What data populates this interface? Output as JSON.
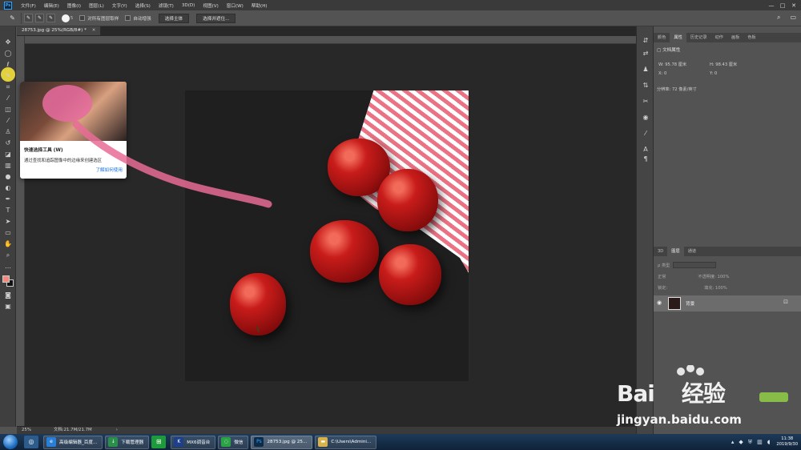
{
  "menu": {
    "items": [
      "文件(F)",
      "编辑(E)",
      "图像(I)",
      "图层(L)",
      "文字(Y)",
      "选择(S)",
      "滤镜(T)",
      "3D(D)",
      "视图(V)",
      "窗口(W)",
      "帮助(H)"
    ],
    "ps_logo": "Ps",
    "minimize": "—",
    "maximize": "□",
    "close": "✕"
  },
  "options": {
    "brush_size": "5",
    "sample_all_label": "对所有图层取样",
    "auto_enhance_label": "自动增强",
    "select_subject": "选择主体",
    "select_mask": "选择并遮住..."
  },
  "document": {
    "tab_title": "28753.jpg @ 25%(RGB/8#) *",
    "tab_close": "✕"
  },
  "tooltip": {
    "title": "快速选择工具 (W)",
    "description": "通过查找和追踪图像中的边缘来创建选区",
    "link": "了解如何使用"
  },
  "status": {
    "zoom": "25%",
    "doc_size": "文档:21.7M/21.7M",
    "arrow": "›"
  },
  "panels": {
    "top_tabs": [
      "颜色",
      "属性",
      "历史记录",
      "动作",
      "画板",
      "色板"
    ],
    "active_top_tab": "属性",
    "props_title": "文档属性",
    "w_label": "W: 95.78 厘米",
    "h_label": "H: 98.43 厘米",
    "x_label": "X: 0",
    "y_label": "Y: 0",
    "resolution": "分辨率: 72 像素/英寸",
    "layer_tabs": [
      "3D",
      "图层",
      "通道"
    ],
    "active_layer_tab": "图层",
    "kind_label": "ρ 类型",
    "mode_label": "正常",
    "opacity_label": "不透明度: 100%",
    "lock_label": "锁定:",
    "fill_label": "填充: 100%",
    "layer_name": "背景"
  },
  "watermark": {
    "logo_text": "Bai",
    "logo_text2": "经验",
    "url": "jingyan.baidu.com"
  },
  "taskbar": {
    "items": [
      {
        "label": "高级编辑器_百度...",
        "color": "#2a7fd4"
      },
      {
        "label": "下载管理器",
        "color": "#2a8f4a"
      },
      {
        "label": "MX6调音台",
        "color": "#1e3f8a"
      },
      {
        "label": "微信",
        "color": "#2ba245"
      },
      {
        "label": "28753.jpg @ 25...",
        "color": "#0d2a48"
      },
      {
        "label": "C:\\Users\\Admini...",
        "color": "#d8b24a"
      }
    ],
    "time": "11:38",
    "date": "2019/9/30"
  }
}
